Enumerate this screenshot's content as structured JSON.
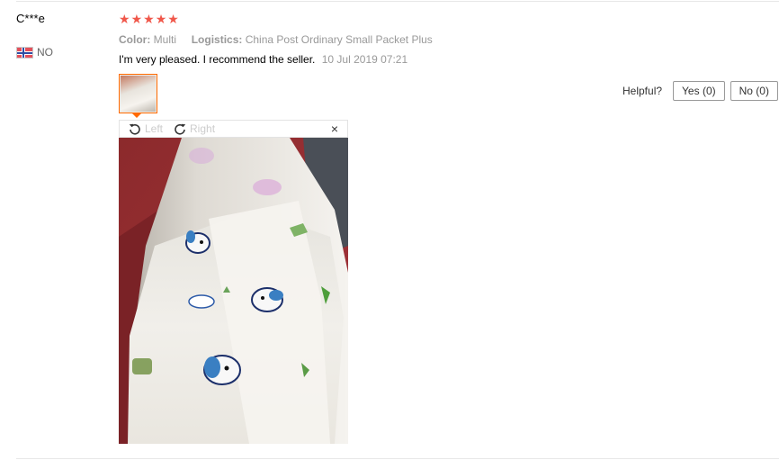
{
  "user": {
    "name": "C***e",
    "country_code": "NO"
  },
  "rating": {
    "stars": 5,
    "max": 5,
    "color": "#f0574a"
  },
  "meta": {
    "color_label": "Color:",
    "color_value": "Multi",
    "logistics_label": "Logistics:",
    "logistics_value": "China Post Ordinary Small Packet Plus"
  },
  "review": {
    "text": "I'm very pleased. I recommend the seller.",
    "date": "10 Jul 2019 07:21"
  },
  "helpful": {
    "label": "Helpful?",
    "yes": "Yes (0)",
    "no": "No (0)"
  },
  "viewer": {
    "rotate_left": "Left",
    "rotate_right": "Right",
    "close": "×"
  },
  "colors": {
    "accent": "#ff6a00"
  }
}
